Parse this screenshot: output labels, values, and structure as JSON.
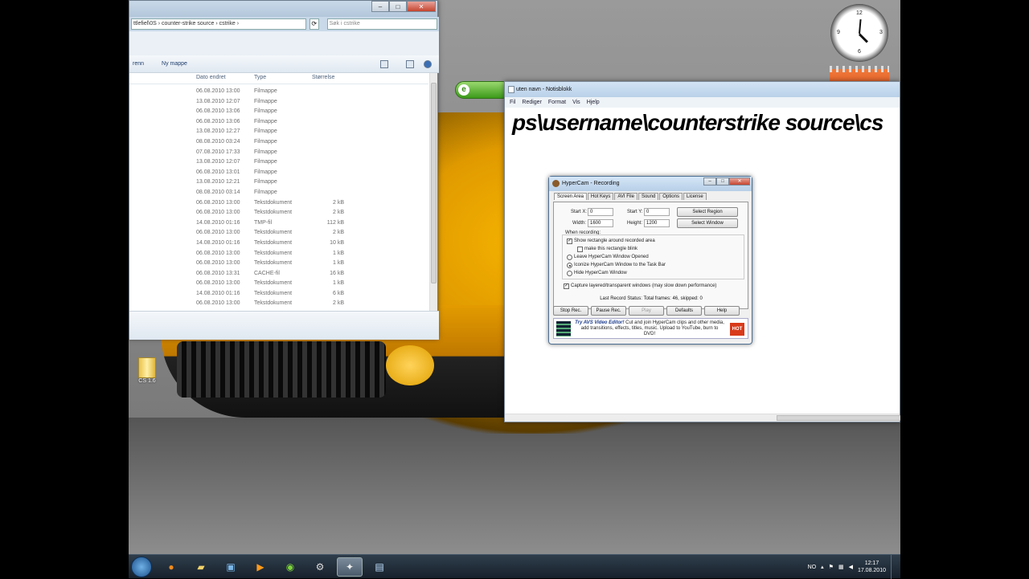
{
  "explorer": {
    "address": "ttlefiel\\0S  ›  counter-strike source  ›  cstrike  ›",
    "search_placeholder": "Søk i cstrike",
    "toolbar": [
      "renn",
      "Ny mappe"
    ],
    "headers": {
      "date": "Dato endret",
      "type": "Type",
      "size": "Størrelse"
    },
    "rows": [
      {
        "date": "06.08.2010 13:00",
        "type": "Filmappe",
        "size": ""
      },
      {
        "date": "13.08.2010 12:07",
        "type": "Filmappe",
        "size": ""
      },
      {
        "date": "06.08.2010 13:06",
        "type": "Filmappe",
        "size": ""
      },
      {
        "date": "06.08.2010 13:06",
        "type": "Filmappe",
        "size": ""
      },
      {
        "date": "13.08.2010 12:27",
        "type": "Filmappe",
        "size": ""
      },
      {
        "date": "08.08.2010 03:24",
        "type": "Filmappe",
        "size": ""
      },
      {
        "date": "07.08.2010 17:33",
        "type": "Filmappe",
        "size": ""
      },
      {
        "date": "13.08.2010 12:07",
        "type": "Filmappe",
        "size": ""
      },
      {
        "date": "06.08.2010 13:01",
        "type": "Filmappe",
        "size": ""
      },
      {
        "date": "13.08.2010 12:21",
        "type": "Filmappe",
        "size": ""
      },
      {
        "date": "08.08.2010 03:14",
        "type": "Filmappe",
        "size": ""
      },
      {
        "date": "06.08.2010 13:00",
        "type": "Tekstdokument",
        "size": "2 kB"
      },
      {
        "date": "06.08.2010 13:00",
        "type": "Tekstdokument",
        "size": "2 kB"
      },
      {
        "date": "14.08.2010 01:16",
        "type": "TMP-fil",
        "size": "112 kB"
      },
      {
        "date": "06.08.2010 13:00",
        "type": "Tekstdokument",
        "size": "2 kB"
      },
      {
        "date": "14.08.2010 01:16",
        "type": "Tekstdokument",
        "size": "10 kB"
      },
      {
        "date": "06.08.2010 13:00",
        "type": "Tekstdokument",
        "size": "1 kB"
      },
      {
        "date": "06.08.2010 13:00",
        "type": "Tekstdokument",
        "size": "1 kB"
      },
      {
        "date": "06.08.2010 13:31",
        "type": "CACHE-fil",
        "size": "16 kB"
      },
      {
        "date": "06.08.2010 13:00",
        "type": "Tekstdokument",
        "size": "1 kB"
      },
      {
        "date": "14.08.2010 01:16",
        "type": "Tekstdokument",
        "size": "6 kB"
      },
      {
        "date": "06.08.2010 13:00",
        "type": "Tekstdokument",
        "size": "2 kB"
      }
    ]
  },
  "notepad": {
    "title": "uten navn - Notisblokk",
    "menu": [
      "Fil",
      "Rediger",
      "Format",
      "Vis",
      "Hjelp"
    ],
    "content": "ps\\username\\counterstrike source\\cs"
  },
  "hypercam": {
    "title": "HyperCam - Recording",
    "tabs": [
      "Screen Area",
      "Hot Keys",
      "AVI File",
      "Sound",
      "Options",
      "License"
    ],
    "start_x_label": "Start X:",
    "start_x": "0",
    "start_y_label": "Start Y:",
    "start_y": "0",
    "width_label": "Width:",
    "width": "1600",
    "height_label": "Height:",
    "height": "1200",
    "select_region": "Select Region",
    "select_window": "Select Window",
    "when_recording": "When recording:",
    "show_rect": "Show rectangle around recorded area",
    "blink": "make this rectangle blink",
    "leave_opened": "Leave HyperCam Window Opened",
    "iconize": "Iconize HyperCam Window to the Task Bar",
    "hide": "Hide HyperCam Window",
    "capture_layered": "Capture layered/transparent windows (may slow down performance)",
    "status": "Last Record Status: Total frames: 46, skipped: 0",
    "buttons": {
      "stop": "Stop Rec.",
      "pause": "Pause Rec.",
      "play": "Play",
      "defaults": "Defaults",
      "help": "Help"
    },
    "ad_title": "Try AVS Video Editor!",
    "ad_text": " Cut and join HyperCam clips and other media, add transitions, effects, titles, music. Upload to YouTube, burn to DVD!",
    "hot": "HOT"
  },
  "desktop": {
    "icon_label": "CS 1.6"
  },
  "clock_gadget": {
    "numbers": [
      "12",
      "3",
      "6",
      "9"
    ]
  },
  "taskbar": {
    "lang": "NO",
    "time": "12:17",
    "date": "17.08.2010",
    "apps": [
      "firefox-icon",
      "explorer-icon",
      "network-icon",
      "media-player-icon",
      "spotify-icon",
      "steam-icon",
      "hypercam-icon",
      "notepad-icon"
    ]
  }
}
